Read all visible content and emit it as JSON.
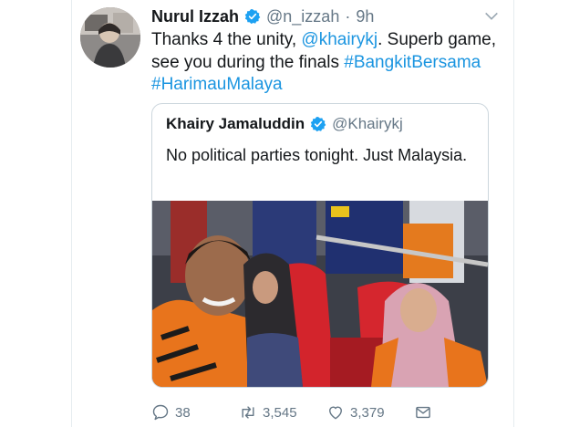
{
  "tweet": {
    "author_name": "Nurul Izzah",
    "handle": "@n_izzah",
    "separator": "·",
    "time": "9h",
    "text_before_mention": "Thanks 4 the unity, ",
    "mention": "@khairykj",
    "text_after_mention": ". Superb game, see you during the finals",
    "hashtag_1": "#BangkitBersama",
    "hashtag_2": "#HarimauMalaya"
  },
  "quote": {
    "author_name": "Khairy Jamaluddin",
    "handle": "@Khairykj",
    "text": "No political parties tonight. Just Malaysia."
  },
  "actions": {
    "replies": "38",
    "retweets": "3,545",
    "likes": "3,379"
  },
  "icons": {
    "verified": "verified-badge-icon",
    "caret": "chevron-down-icon",
    "reply": "reply-icon",
    "retweet": "retweet-icon",
    "like": "heart-icon",
    "dm": "envelope-icon"
  },
  "colors": {
    "link": "#1b95e0",
    "verified": "#1da1f2",
    "secondary_text": "#657786"
  }
}
